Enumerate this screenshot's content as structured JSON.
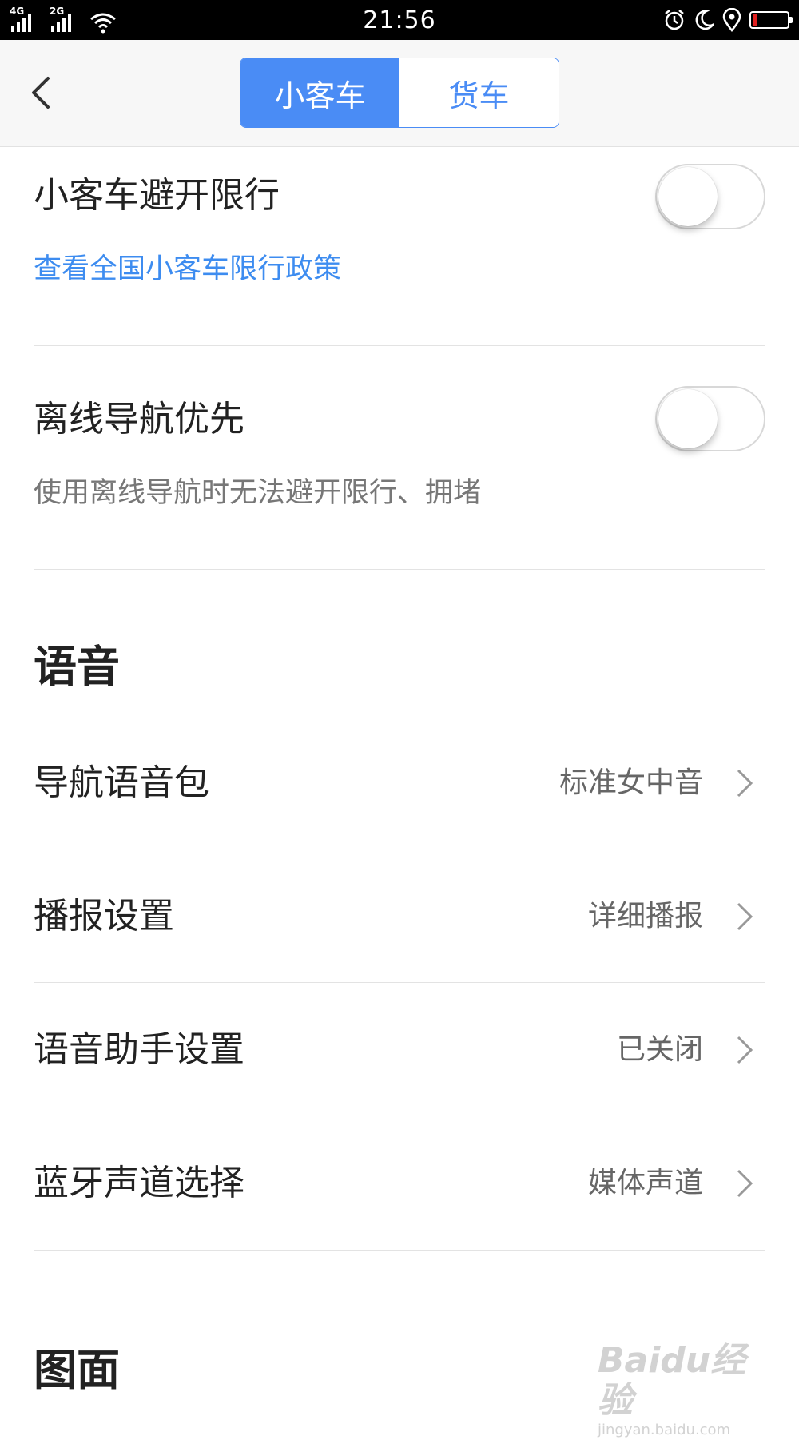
{
  "status_bar": {
    "network_1": "4G",
    "network_2": "2G",
    "time": "21:56",
    "battery_level": 0.15,
    "icons": [
      "alarm-icon",
      "moon-icon",
      "location-icon",
      "battery-icon"
    ]
  },
  "header": {
    "tabs": [
      {
        "label": "小客车",
        "active": true
      },
      {
        "label": "货车",
        "active": false
      }
    ]
  },
  "settings": {
    "restriction": {
      "title": "小客车避开限行",
      "link": "查看全国小客车限行政策",
      "enabled": false
    },
    "offline": {
      "title": "离线导航优先",
      "desc": "使用离线导航时无法避开限行、拥堵",
      "enabled": false
    }
  },
  "voice_section": {
    "title": "语音",
    "items": [
      {
        "label": "导航语音包",
        "value": "标准女中音"
      },
      {
        "label": "播报设置",
        "value": "详细播报"
      },
      {
        "label": "语音助手设置",
        "value": "已关闭"
      },
      {
        "label": "蓝牙声道选择",
        "value": "媒体声道"
      }
    ]
  },
  "display_section": {
    "title": "图面"
  },
  "watermark": {
    "brand": "Baidu经验",
    "url": "jingyan.baidu.com"
  },
  "colors": {
    "accent": "#4a8cf5",
    "link": "#3d8cf0",
    "battery_low": "#e02020"
  }
}
